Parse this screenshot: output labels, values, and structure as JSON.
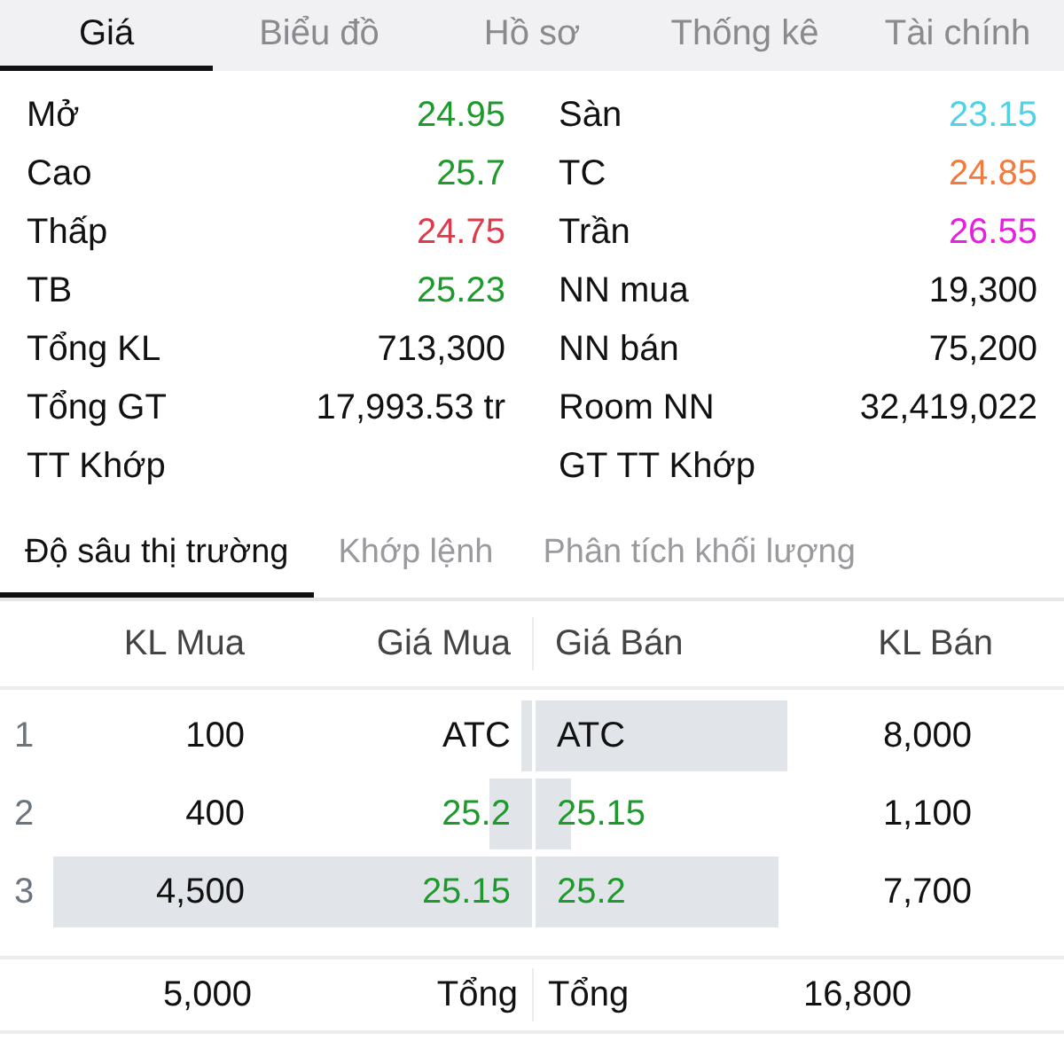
{
  "tabs": [
    {
      "label": "Giá",
      "selected": true
    },
    {
      "label": "Biểu đồ",
      "selected": false
    },
    {
      "label": "Hồ sơ",
      "selected": false
    },
    {
      "label": "Thống kê",
      "selected": false
    },
    {
      "label": "Tài chính",
      "selected": false
    }
  ],
  "stats_left": [
    {
      "label": "Mở",
      "value": "24.95",
      "color": "#1e9a2c"
    },
    {
      "label": "Cao",
      "value": "25.7",
      "color": "#1e9a2c"
    },
    {
      "label": "Thấp",
      "value": "24.75",
      "color": "#e0394b"
    },
    {
      "label": "TB",
      "value": "25.23",
      "color": "#1e9a2c"
    },
    {
      "label": "Tổng KL",
      "value": "713,300",
      "color": "#111111"
    },
    {
      "label": "Tổng GT",
      "value": "17,993.53 tr",
      "color": "#111111"
    },
    {
      "label": "TT Khớp"
    }
  ],
  "stats_right": [
    {
      "label": "Sàn",
      "value": "23.15",
      "color": "#4fd2e8"
    },
    {
      "label": "TC",
      "value": "24.85",
      "color": "#f27a3c"
    },
    {
      "label": "Trần",
      "value": "26.55",
      "color": "#e81ee0"
    },
    {
      "label": "NN mua",
      "value": "19,300",
      "color": "#111111"
    },
    {
      "label": "NN bán",
      "value": "75,200",
      "color": "#111111"
    },
    {
      "label": "Room NN",
      "value": "32,419,022",
      "color": "#111111"
    },
    {
      "label": "GT TT Khớp"
    }
  ],
  "subtabs": [
    {
      "label": "Độ sâu thị trường",
      "selected": true
    },
    {
      "label": "Khớp lệnh",
      "selected": false
    },
    {
      "label": "Phân tích khối lượng",
      "selected": false
    }
  ],
  "depth_table": {
    "columns": [
      "KL Mua",
      "Giá Mua",
      "Giá Bán",
      "KL Bán"
    ],
    "rows": [
      {
        "index": "1",
        "bid": {
          "volume": "100",
          "price": "ATC",
          "color": "#111111"
        },
        "ask": {
          "price": "ATC",
          "color": "#111111",
          "volume": "8,000"
        }
      },
      {
        "index": "2",
        "bid": {
          "volume": "400",
          "price": "25.2",
          "color": "#1e9a2c"
        },
        "ask": {
          "price": "25.15",
          "color": "#1e9a2c",
          "volume": "1,100"
        }
      },
      {
        "index": "3",
        "bid": {
          "volume": "4,500",
          "price": "25.15",
          "color": "#1e9a2c"
        },
        "ask": {
          "price": "25.2",
          "color": "#1e9a2c",
          "volume": "7,700"
        }
      }
    ],
    "totals": {
      "bid_volume": "5,000",
      "bid_label": "Tổng",
      "ask_label": "Tổng",
      "ask_volume": "16,800"
    }
  }
}
